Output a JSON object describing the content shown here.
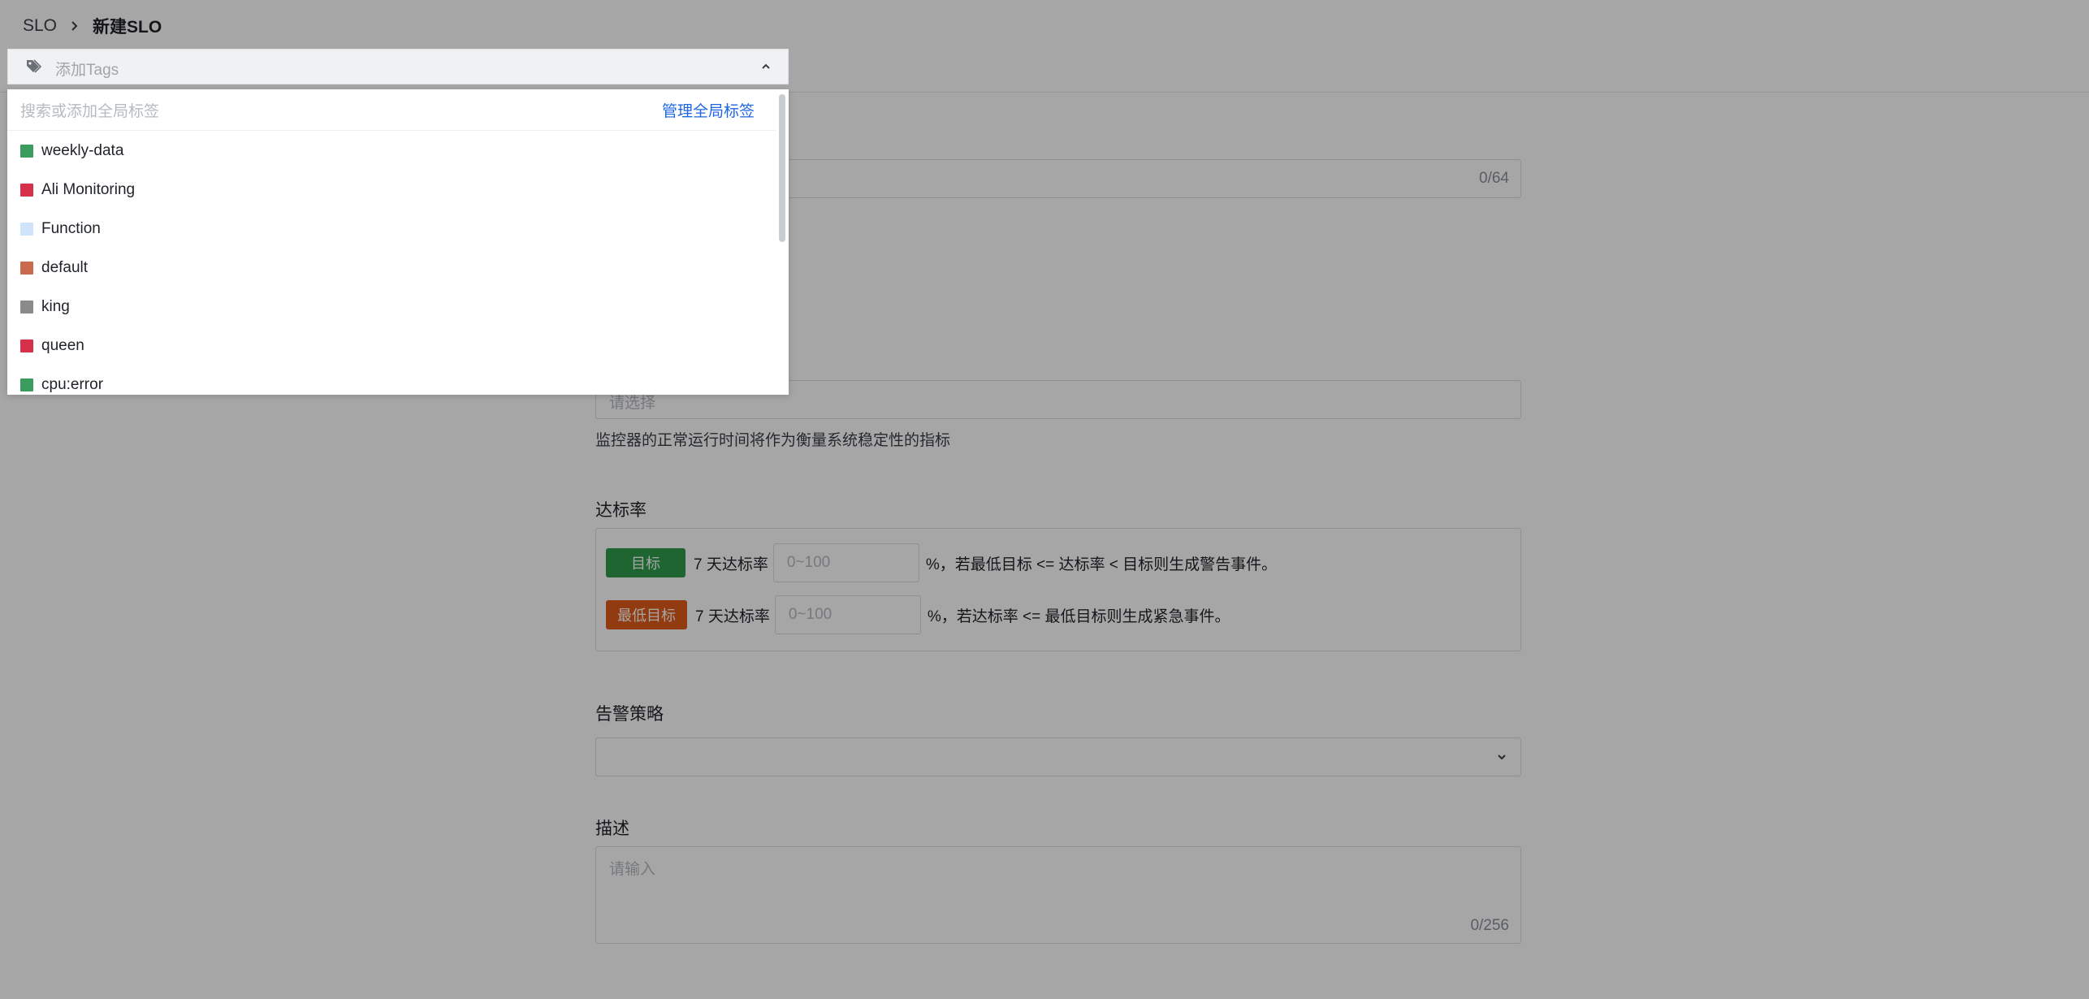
{
  "breadcrumb": {
    "root": "SLO",
    "current": "新建SLO"
  },
  "name_field": {
    "counter": "0/64"
  },
  "monitor_field": {
    "placeholder": "请选择",
    "help": "监控器的正常运行时间将作为衡量系统稳定性的指标"
  },
  "rate_section": {
    "title": "达标率",
    "target_badge": "目标",
    "min_target_badge": "最低目标",
    "period_label": "7 天达标率",
    "input_placeholder": "0~100",
    "target_suffix": "%，若最低目标 <= 达标率 < 目标则生成警告事件。",
    "min_target_suffix": "%，若达标率 <= 最低目标则生成紧急事件。"
  },
  "alert_section": {
    "title": "告警策略"
  },
  "description_section": {
    "title": "描述",
    "placeholder": "请输入",
    "counter": "0/256"
  },
  "tags_select": {
    "placeholder": "添加Tags"
  },
  "dropdown": {
    "search_placeholder": "搜索或添加全局标签",
    "manage_link": "管理全局标签",
    "items": [
      {
        "label": "weekly-data",
        "color": "#3c9b5e"
      },
      {
        "label": "Ali Monitoring",
        "color": "#d6304a"
      },
      {
        "label": "Function",
        "color": "#cfe4fb"
      },
      {
        "label": "default",
        "color": "#c96a4c"
      },
      {
        "label": "king",
        "color": "#8a8a8a"
      },
      {
        "label": "queen",
        "color": "#d6304a"
      },
      {
        "label": "cpu:error",
        "color": "#3c9b5e"
      }
    ]
  },
  "colors": {
    "link": "#1e66e3",
    "badge_green": "#2e9b4c",
    "badge_orange": "#e05a1a"
  }
}
